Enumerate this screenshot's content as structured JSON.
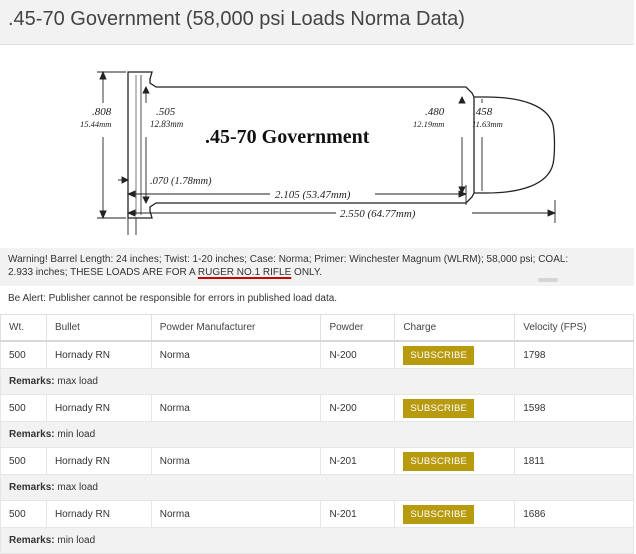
{
  "page": {
    "title": ".45-70 Government (58,000 psi Loads Norma Data)"
  },
  "diagram": {
    "cartridge_name": ".45-70 Government",
    "rim_in": ".808",
    "rim_mm": "15.44mm",
    "base_in": ".505",
    "base_mm": "12.83mm",
    "neck_in": ".480",
    "neck_mm": "12.19mm",
    "bullet_in": ".458",
    "bullet_mm": "11.63mm",
    "rim_thick": ".070 (1.78mm)",
    "case_len": "2.105 (53.47mm)",
    "oal": "2.550 (64.77mm)"
  },
  "warning": {
    "text_before": "Warning! Barrel Length: 24 inches; Twist: 1-20 inches; Case: Norma; Primer: Winchester Magnum (WLRM); 58,000 psi; COAL: 2.933 inches; THESE LOADS ARE FOR A ",
    "highlight": "RUGER NO.1 RIFLE",
    "text_after": " ONLY."
  },
  "alert": "Be Alert: Publisher cannot be responsible for errors in published load data.",
  "table": {
    "headers": [
      "Wt.",
      "Bullet",
      "Powder Manufacturer",
      "Powder",
      "Charge",
      "Velocity (FPS)"
    ],
    "remarks_label": "Remarks:",
    "rows": [
      {
        "wt": "500",
        "bullet": "Hornady RN",
        "mfr": "Norma",
        "powder": "N-200",
        "charge": "SUBSCRIBE",
        "velocity": "1798",
        "remarks": "max load"
      },
      {
        "wt": "500",
        "bullet": "Hornady RN",
        "mfr": "Norma",
        "powder": "N-200",
        "charge": "SUBSCRIBE",
        "velocity": "1598",
        "remarks": "min load"
      },
      {
        "wt": "500",
        "bullet": "Hornady RN",
        "mfr": "Norma",
        "powder": "N-201",
        "charge": "SUBSCRIBE",
        "velocity": "1811",
        "remarks": "max load"
      },
      {
        "wt": "500",
        "bullet": "Hornady RN",
        "mfr": "Norma",
        "powder": "N-201",
        "charge": "SUBSCRIBE",
        "velocity": "1686",
        "remarks": "min load"
      }
    ]
  },
  "colors": {
    "subscribe_button": "#b89a0e",
    "title_bar": "#f2f2f2",
    "underline": "#cc0000"
  }
}
